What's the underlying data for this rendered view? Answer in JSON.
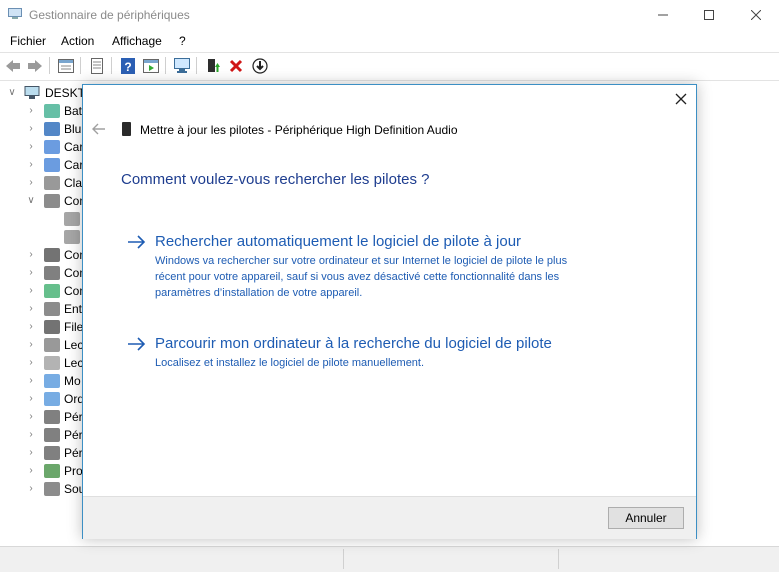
{
  "window": {
    "title": "Gestionnaire de périphériques"
  },
  "menu": [
    "Fichier",
    "Action",
    "Affichage",
    "?"
  ],
  "tree": {
    "root": "DESKTOP",
    "items": [
      {
        "label": "Bat"
      },
      {
        "label": "Blu"
      },
      {
        "label": "Car"
      },
      {
        "label": "Car"
      },
      {
        "label": "Clav"
      },
      {
        "label": "Con"
      },
      {
        "label": ""
      },
      {
        "label": ""
      },
      {
        "label": "Con"
      },
      {
        "label": "Con"
      },
      {
        "label": "Con"
      },
      {
        "label": "Ent"
      },
      {
        "label": "File"
      },
      {
        "label": "Lec"
      },
      {
        "label": "Lec"
      },
      {
        "label": "Mo"
      },
      {
        "label": "Ord"
      },
      {
        "label": "Pér"
      },
      {
        "label": "Pér"
      },
      {
        "label": "Pér"
      },
      {
        "label": "Pro"
      },
      {
        "label": "Sou"
      }
    ]
  },
  "dialog": {
    "title": "Mettre à jour les pilotes - Périphérique High Definition Audio",
    "question": "Comment voulez-vous rechercher les pilotes ?",
    "options": [
      {
        "title": "Rechercher automatiquement le logiciel de pilote à jour",
        "description": "Windows va rechercher sur votre ordinateur et sur Internet le logiciel de pilote le plus récent pour votre appareil, sauf si vous avez désactivé cette fonctionnalité dans les paramètres d’installation de votre appareil."
      },
      {
        "title": "Parcourir mon ordinateur à la recherche du logiciel de pilote",
        "description": "Localisez et installez le logiciel de pilote manuellement."
      }
    ],
    "cancel_label": "Annuler"
  },
  "colors": {
    "accent": "#1e5cb3",
    "heading": "#1e3d8f",
    "dialog_border": "#3c8fc4"
  }
}
